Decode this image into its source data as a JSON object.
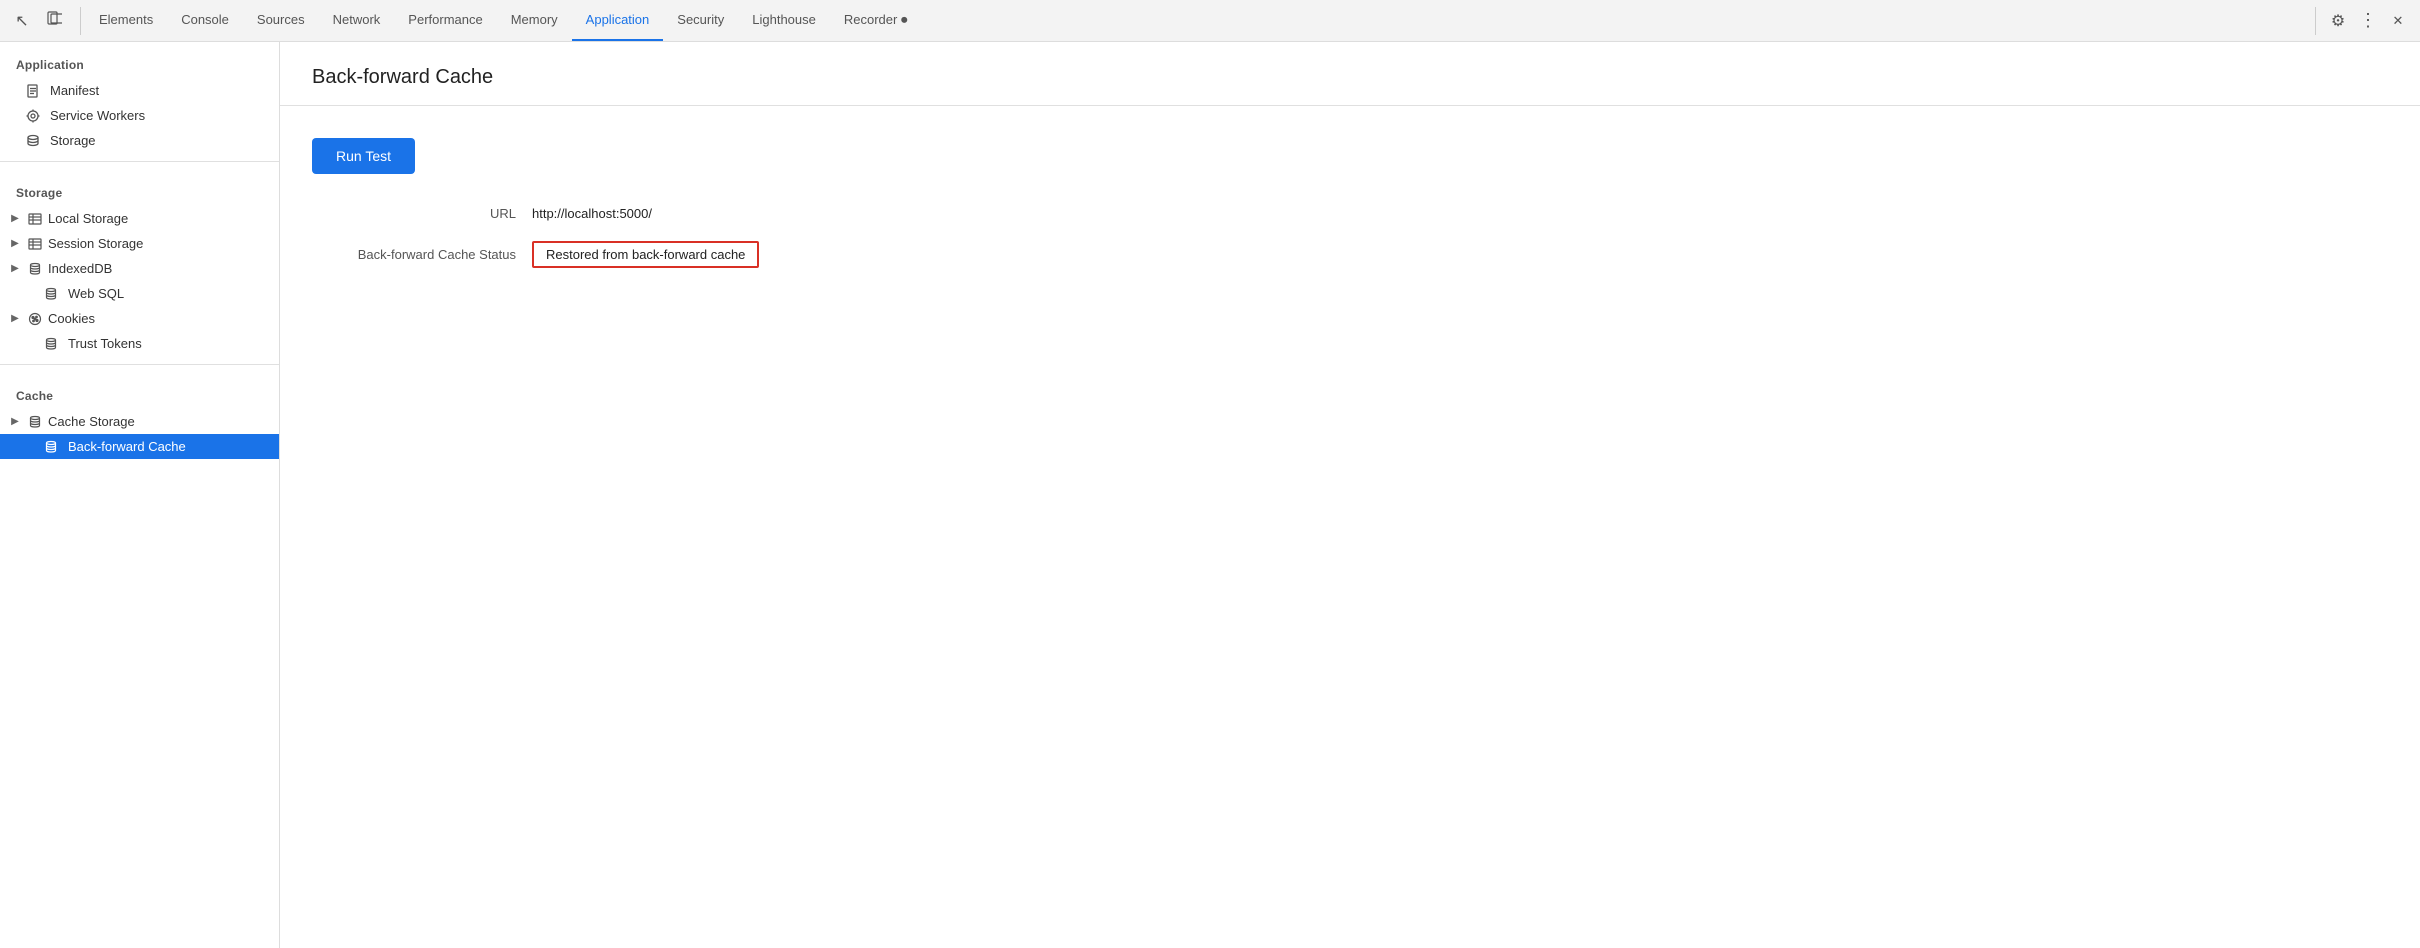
{
  "toolbar": {
    "tabs": [
      {
        "label": "Elements",
        "active": false
      },
      {
        "label": "Console",
        "active": false
      },
      {
        "label": "Sources",
        "active": false
      },
      {
        "label": "Network",
        "active": false
      },
      {
        "label": "Performance",
        "active": false
      },
      {
        "label": "Memory",
        "active": false
      },
      {
        "label": "Application",
        "active": true
      },
      {
        "label": "Security",
        "active": false
      },
      {
        "label": "Lighthouse",
        "active": false
      },
      {
        "label": "Recorder ⏺",
        "active": false
      }
    ],
    "settings_icon": "⚙",
    "more_icon": "⋮",
    "close_icon": "✕"
  },
  "sidebar": {
    "application_section": "Application",
    "items_application": [
      {
        "label": "Manifest",
        "icon": "manifest"
      },
      {
        "label": "Service Workers",
        "icon": "gear"
      },
      {
        "label": "Storage",
        "icon": "storage"
      }
    ],
    "storage_section": "Storage",
    "items_storage": [
      {
        "label": "Local Storage",
        "icon": "table",
        "expandable": true
      },
      {
        "label": "Session Storage",
        "icon": "table",
        "expandable": true
      },
      {
        "label": "IndexedDB",
        "icon": "database",
        "expandable": true
      },
      {
        "label": "Web SQL",
        "icon": "database"
      },
      {
        "label": "Cookies",
        "icon": "cookie",
        "expandable": true
      },
      {
        "label": "Trust Tokens",
        "icon": "database"
      }
    ],
    "cache_section": "Cache",
    "items_cache": [
      {
        "label": "Cache Storage",
        "icon": "cache",
        "expandable": true
      },
      {
        "label": "Back-forward Cache",
        "icon": "cache",
        "active": true
      }
    ]
  },
  "content": {
    "title": "Back-forward Cache",
    "run_test_btn": "Run Test",
    "url_label": "URL",
    "url_value": "http://localhost:5000/",
    "status_label": "Back-forward Cache Status",
    "status_value": "Restored from back-forward cache"
  }
}
